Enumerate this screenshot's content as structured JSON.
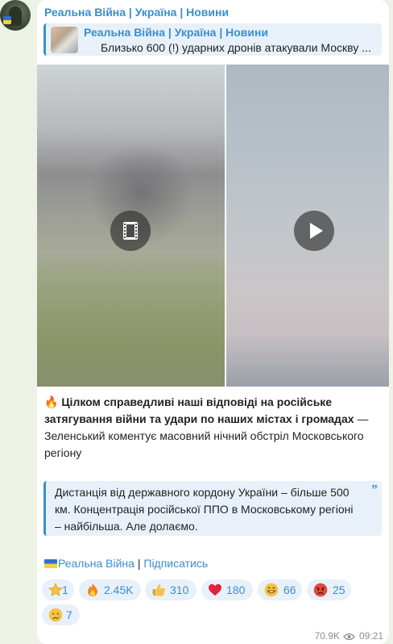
{
  "channel": {
    "name": "Реальна Війна | Україна | Новини"
  },
  "forwarded": {
    "title": "Реальна Війна | Україна | Новини",
    "text": "Близько 600 (!) ударних дронів атакували Москву ..."
  },
  "media": [
    {
      "kind": "video",
      "icon": "film-icon"
    },
    {
      "kind": "video",
      "icon": "play-icon"
    }
  ],
  "post": {
    "emoji": "🔥",
    "bold_text": "Цілком справедливі наші відповіді на російське затягування війни та удари по наших містах і громадах",
    "body_text": " — Зеленський коментує масовний нічний обстріл Московського регіону"
  },
  "quote": {
    "text": "Дистанція від державного кордону України – більше 500 км. Концентрація російської ППО в Московському регіоні – найбільша. Але долаємо.",
    "mark": "”"
  },
  "signature": {
    "channel_link": "Реальна Війна",
    "separator": " | ",
    "subscribe_link": "Підписатись"
  },
  "reactions": [
    {
      "emoji": "star-icon",
      "count": "1",
      "color": "#f5c242"
    },
    {
      "emoji": "fire-icon",
      "count": "2.45K",
      "color": "#f08a24"
    },
    {
      "emoji": "thumbs-up-icon",
      "count": "310",
      "color": "#f4c24a"
    },
    {
      "emoji": "heart-icon",
      "count": "180",
      "color": "#e0243a"
    },
    {
      "emoji": "grin-icon",
      "count": "66",
      "color": "#f5c242"
    },
    {
      "emoji": "angry-icon",
      "count": "25",
      "color": "#e2483a"
    },
    {
      "emoji": "cry-icon",
      "count": "7",
      "color": "#f5c242"
    }
  ],
  "meta": {
    "views": "70.9K",
    "time": "09:21"
  },
  "colors": {
    "accent": "#3a8ed0",
    "bubble": "#ffffff",
    "background": "#eef1e6"
  }
}
